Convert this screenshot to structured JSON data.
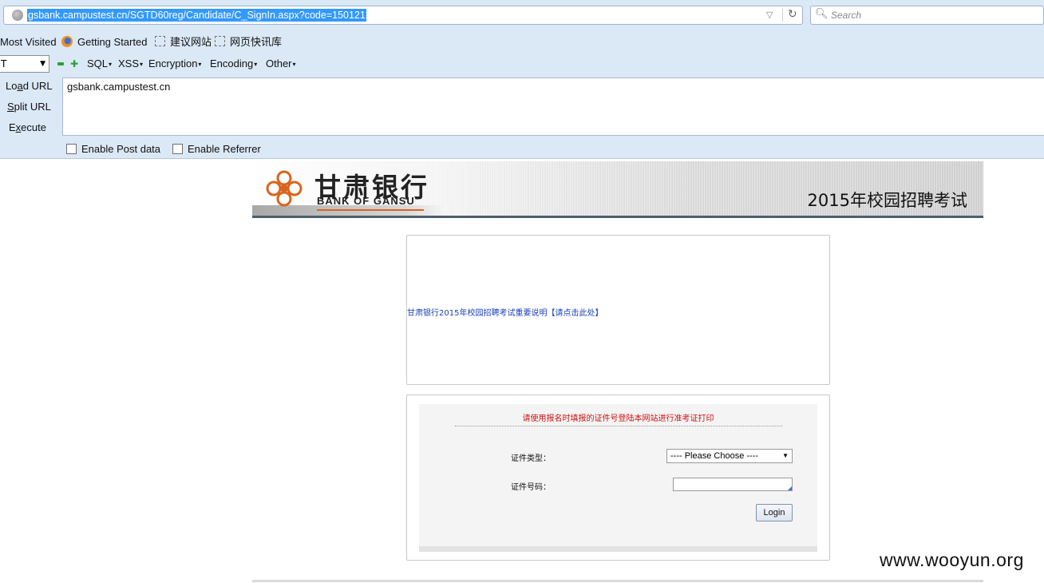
{
  "browser": {
    "url": "gsbank.campustest.cn/SGTD60reg/Candidate/C_SignIn.aspx?code=150121",
    "search_placeholder": "Search",
    "icons": {
      "site": "globe-icon",
      "dropdown": "history-dropdown-icon",
      "reload": "reload-icon",
      "search": "magnifier-icon"
    }
  },
  "bookmarks": [
    {
      "label": "Most Visited"
    },
    {
      "label": "Getting Started",
      "icon": "firefox-icon"
    },
    {
      "label": "建议网站",
      "icon": "placeholder-page-icon"
    },
    {
      "label": "网页快讯库",
      "icon": "placeholder-page-icon"
    }
  ],
  "hackbar": {
    "method_value": "T",
    "menus": [
      {
        "label": "SQL"
      },
      {
        "label": "XSS"
      },
      {
        "label": "Encryption"
      },
      {
        "label": "Encoding"
      },
      {
        "label": "Other"
      }
    ],
    "load_url": {
      "ul": "a",
      "pre": "Lo",
      "post": "d URL"
    },
    "split_url": {
      "ul": "S",
      "pre": "",
      "post": "plit URL"
    },
    "execute": {
      "ul": "x",
      "pre": "E",
      "post": "ecute"
    },
    "url_value": "gsbank.campustest.cn",
    "enable_post": "Enable Post data",
    "enable_referrer": "Enable Referrer"
  },
  "page": {
    "bank_name_cn": "甘肃银行",
    "bank_name_en": "BANK OF GANSU",
    "exam_title": "2015年校园招聘考试",
    "notice_link": "甘肃银行2015年校园招聘考试重要说明【请点击此处】",
    "login": {
      "instruction": "请使用报名时填报的证件号登陆本网站进行准考证打印",
      "id_type_label": "证件类型：",
      "id_type_value": "---- Please Choose ----",
      "id_number_label": "证件号码：",
      "id_number_value": "",
      "login_button": "Login"
    },
    "colors": {
      "link": "#1a3fb8",
      "instruction": "#cc1111",
      "logo_accent": "#d9651d",
      "banner_rule": "#4c5f6d"
    }
  },
  "watermark": "www.wooyun.org"
}
